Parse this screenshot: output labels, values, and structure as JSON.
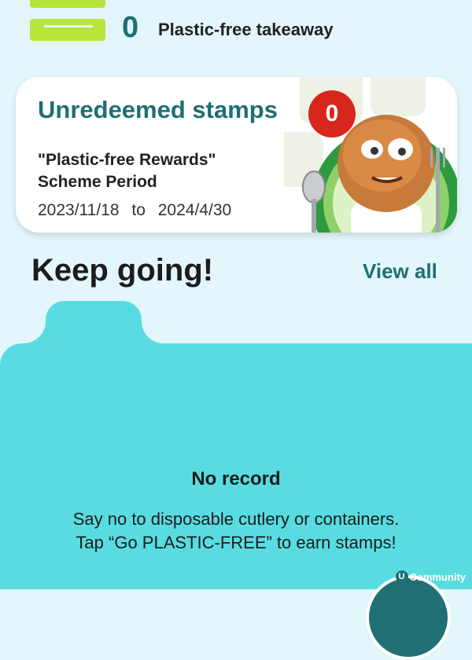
{
  "stat": {
    "icon": "cutlery-container-icon",
    "count": "0",
    "label": "Plastic-free takeaway"
  },
  "card": {
    "title": "Unredeemed stamps",
    "badge": "0",
    "scheme_line1": "\"Plastic-free Rewards\"",
    "scheme_line2": "Scheme Period",
    "start": "2023/11/18",
    "to": "to",
    "end": "2024/4/30",
    "mascot_icon": "mascot-with-cutlery"
  },
  "section": {
    "title": "Keep going!",
    "view_all": "View all"
  },
  "panel": {
    "empty_title": "No record",
    "hint_line1": "Say no to disposable cutlery or containers.",
    "hint_line2": "Tap “Go PLASTIC-FREE” to earn stamps!"
  },
  "watermark": {
    "u": "U",
    "text": "Community"
  },
  "colors": {
    "accent": "#1f6f73",
    "badge": "#d8261c",
    "panel": "#59dce1",
    "background": "#e3f6fb",
    "lime": "#b6e63a"
  }
}
